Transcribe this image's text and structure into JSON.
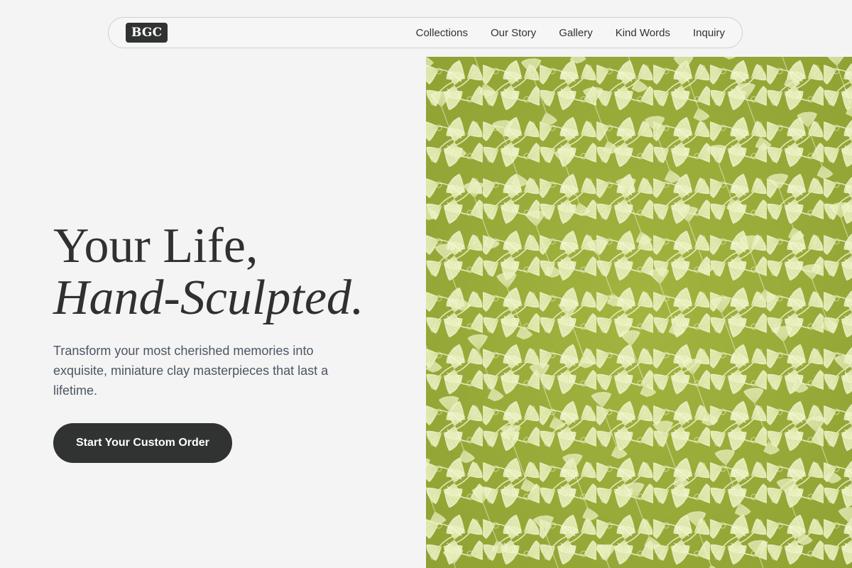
{
  "nav": {
    "logo": "BGC",
    "links": [
      "Collections",
      "Our Story",
      "Gallery",
      "Kind Words",
      "Inquiry"
    ]
  },
  "hero": {
    "title_line1": "Your Life,",
    "title_line2": "Hand-Sculpted.",
    "subtitle": "Transform your most cherished memories into exquisite, miniature clay masterpieces that last a lifetime.",
    "cta_label": "Start Your Custom Order"
  },
  "pattern": {
    "icon": "ginkgo-leaf-pattern",
    "base_color": "#9aac3a",
    "leaf_color": "#eef2c4",
    "stem_color": "#f3f5d6"
  },
  "colors": {
    "background": "#f4f4f4",
    "dark": "#303331",
    "body_text": "#4b5663"
  }
}
